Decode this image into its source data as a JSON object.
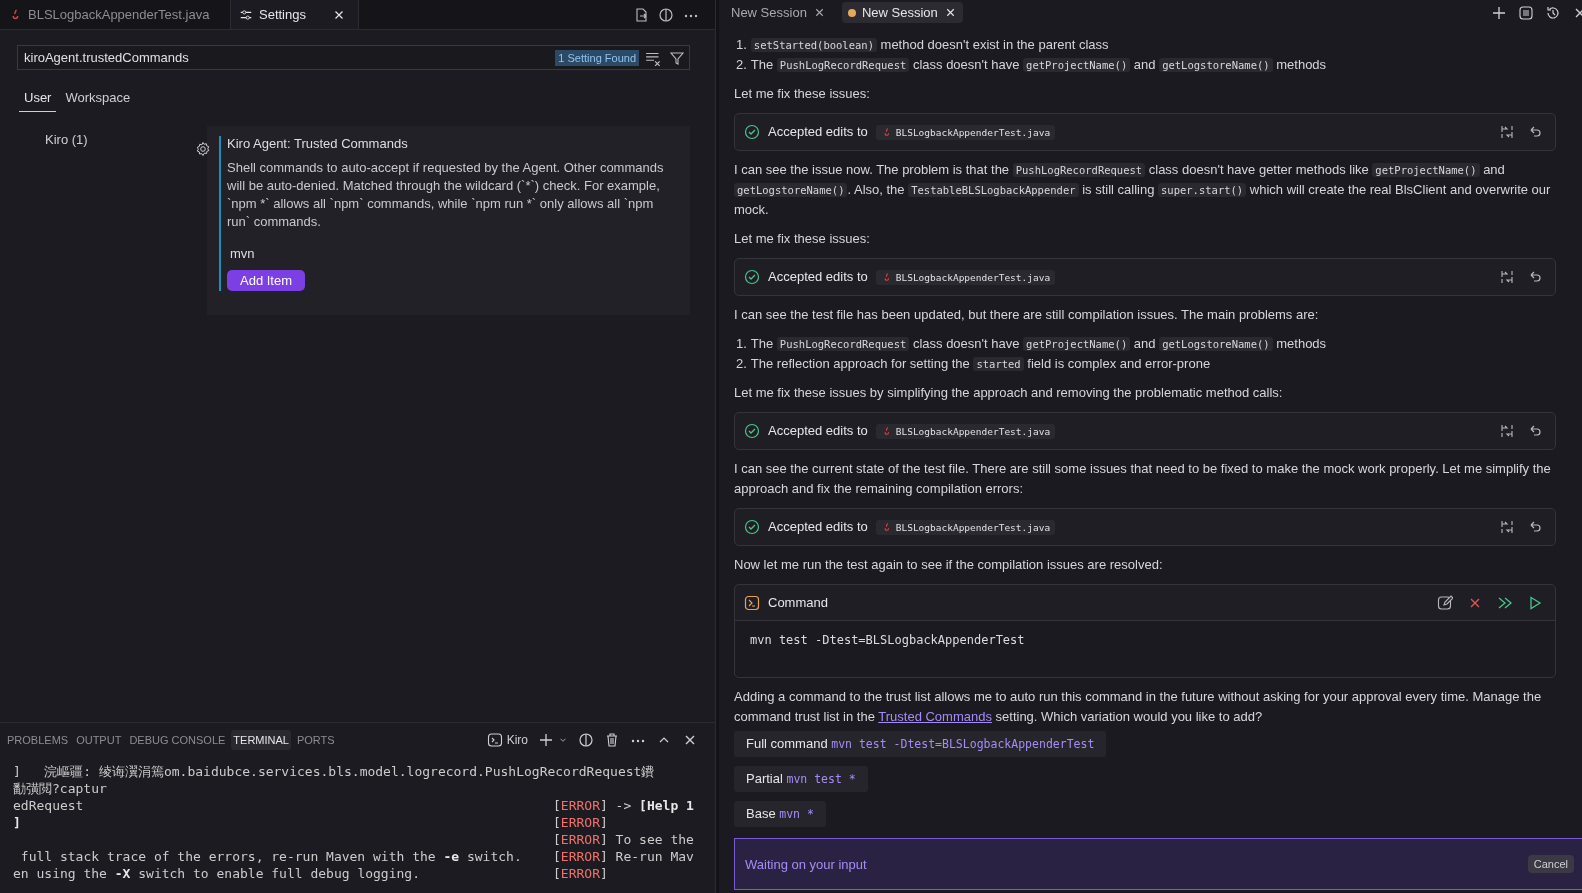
{
  "editor_tabs": [
    {
      "label": "BLSLogbackAppenderTest.java",
      "selected": false,
      "kind": "java"
    },
    {
      "label": "Settings",
      "selected": true,
      "kind": "settings"
    }
  ],
  "settings": {
    "search": {
      "value": "kiroAgent.trustedCommands"
    },
    "result_badge": "1 Setting Found",
    "scopes": [
      {
        "label": "User",
        "selected": true
      },
      {
        "label": "Workspace",
        "selected": false
      }
    ],
    "toc": [
      {
        "label": "Kiro (1)"
      }
    ],
    "setting": {
      "title": "Kiro Agent: Trusted Commands",
      "description": "Shell commands to auto-accept if requested by the Agent. Other commands will be auto-denied. Matched through the wildcard (`*`) check. For example, `npm *` allows all `npm` commands, while `npm run *` only allows all `npm run` commands.",
      "items": [
        "mvn"
      ],
      "add_button": "Add Item"
    }
  },
  "panel": {
    "tabs": [
      {
        "label": "PROBLEMS",
        "selected": false
      },
      {
        "label": "OUTPUT",
        "selected": false
      },
      {
        "label": "DEBUG CONSOLE",
        "selected": false
      },
      {
        "label": "TERMINAL",
        "selected": true
      },
      {
        "label": "PORTS",
        "selected": false
      }
    ],
    "terminal_profile": "Kiro",
    "terminal": [
      {
        "kind": "full",
        "left": [
          {
            "kind": "text",
            "text": "]   浣嶇疆: 绫诲瀷涓篶om.baidubce.services.bls.model.logrecord.PushLogRecordRequest鐨"
          }
        ]
      },
      {
        "kind": "full",
        "left": [
          {
            "kind": "text",
            "text": "勫彉閲?captur"
          }
        ]
      },
      {
        "kind": "split",
        "left": [
          {
            "kind": "text",
            "text": "edRequest"
          }
        ],
        "right": [
          {
            "kind": "text",
            "text": "["
          },
          {
            "kind": "error",
            "text": "ERROR"
          },
          {
            "kind": "text",
            "text": "] -> "
          },
          {
            "kind": "bold",
            "text": "[Help 1"
          }
        ]
      },
      {
        "kind": "split",
        "left": [
          {
            "kind": "bold",
            "text": "]"
          }
        ],
        "right": [
          {
            "kind": "text",
            "text": "["
          },
          {
            "kind": "error",
            "text": "ERROR"
          },
          {
            "kind": "text",
            "text": "]"
          }
        ]
      },
      {
        "kind": "split",
        "right": [
          {
            "kind": "text",
            "text": "["
          },
          {
            "kind": "error",
            "text": "ERROR"
          },
          {
            "kind": "text",
            "text": "] To see the"
          }
        ]
      },
      {
        "kind": "split",
        "left": [
          {
            "kind": "text",
            "text": " full stack trace of the errors, re-run Maven with the "
          },
          {
            "kind": "bold",
            "text": "-e"
          },
          {
            "kind": "text",
            "text": " switch."
          }
        ],
        "right": [
          {
            "kind": "text",
            "text": "["
          },
          {
            "kind": "error",
            "text": "ERROR"
          },
          {
            "kind": "text",
            "text": "] Re-run Mav"
          }
        ]
      },
      {
        "kind": "split",
        "left": [
          {
            "kind": "text",
            "text": "en using the "
          },
          {
            "kind": "bold",
            "text": "-X"
          },
          {
            "kind": "text",
            "text": " switch to enable full debug logging."
          }
        ],
        "right": [
          {
            "kind": "text",
            "text": "["
          },
          {
            "kind": "error",
            "text": "ERROR"
          },
          {
            "kind": "text",
            "text": "]"
          }
        ]
      }
    ]
  },
  "chat": {
    "tabs": [
      {
        "label": "New Session",
        "selected": false,
        "unsaved": false
      },
      {
        "label": "New Session",
        "selected": true,
        "unsaved": true
      }
    ],
    "messages": [
      {
        "kind": "list",
        "items": [
          {
            "marker": "1.",
            "segments": [
              {
                "kind": "code",
                "text": "setStarted(boolean)"
              },
              {
                "kind": "text",
                "text": " method doesn't exist in the parent class"
              }
            ]
          },
          {
            "marker": "2.",
            "segments": [
              {
                "kind": "text",
                "text": "The "
              },
              {
                "kind": "code",
                "text": "PushLogRecordRequest"
              },
              {
                "kind": "text",
                "text": " class doesn't have "
              },
              {
                "kind": "code",
                "text": "getProjectName()"
              },
              {
                "kind": "text",
                "text": " and "
              },
              {
                "kind": "code",
                "text": "getLogstoreName()"
              },
              {
                "kind": "text",
                "text": " methods"
              }
            ]
          }
        ]
      },
      {
        "kind": "para",
        "segments": [
          {
            "kind": "text",
            "text": "Let me fix these issues:"
          }
        ]
      },
      {
        "kind": "edit",
        "label": "Accepted edits to",
        "file": "BLSLogbackAppenderTest.java"
      },
      {
        "kind": "para",
        "segments": [
          {
            "kind": "text",
            "text": "I can see the issue now. The problem is that the "
          },
          {
            "kind": "code",
            "text": "PushLogRecordRequest"
          },
          {
            "kind": "text",
            "text": " class doesn't have getter methods like "
          },
          {
            "kind": "code",
            "text": "getProjectName()"
          },
          {
            "kind": "text",
            "text": " and "
          },
          {
            "kind": "code",
            "text": "getLogstoreName()"
          },
          {
            "kind": "text",
            "text": ". Also, the "
          },
          {
            "kind": "code",
            "text": "TestableBLSLogbackAppender"
          },
          {
            "kind": "text",
            "text": " is still calling "
          },
          {
            "kind": "code",
            "text": "super.start()"
          },
          {
            "kind": "text",
            "text": " which will create the real BlsClient and overwrite our mock."
          }
        ]
      },
      {
        "kind": "para",
        "segments": [
          {
            "kind": "text",
            "text": "Let me fix these issues:"
          }
        ]
      },
      {
        "kind": "edit",
        "label": "Accepted edits to",
        "file": "BLSLogbackAppenderTest.java"
      },
      {
        "kind": "para",
        "segments": [
          {
            "kind": "text",
            "text": "I can see the test file has been updated, but there are still compilation issues. The main problems are:"
          }
        ]
      },
      {
        "kind": "list",
        "items": [
          {
            "marker": "1.",
            "segments": [
              {
                "kind": "text",
                "text": "The "
              },
              {
                "kind": "code",
                "text": "PushLogRecordRequest"
              },
              {
                "kind": "text",
                "text": " class doesn't have "
              },
              {
                "kind": "code",
                "text": "getProjectName()"
              },
              {
                "kind": "text",
                "text": " and "
              },
              {
                "kind": "code",
                "text": "getLogstoreName()"
              },
              {
                "kind": "text",
                "text": " methods"
              }
            ]
          },
          {
            "marker": "2.",
            "segments": [
              {
                "kind": "text",
                "text": "The reflection approach for setting the "
              },
              {
                "kind": "code",
                "text": "started"
              },
              {
                "kind": "text",
                "text": " field is complex and error-prone"
              }
            ]
          }
        ]
      },
      {
        "kind": "para",
        "segments": [
          {
            "kind": "text",
            "text": "Let me fix these issues by simplifying the approach and removing the problematic method calls:"
          }
        ]
      },
      {
        "kind": "edit",
        "label": "Accepted edits to",
        "file": "BLSLogbackAppenderTest.java"
      },
      {
        "kind": "para",
        "segments": [
          {
            "kind": "text",
            "text": "I can see the current state of the test file. There are still some issues that need to be fixed to make the mock work properly. Let me simplify the approach and fix the remaining compilation errors:"
          }
        ]
      },
      {
        "kind": "edit",
        "label": "Accepted edits to",
        "file": "BLSLogbackAppenderTest.java"
      },
      {
        "kind": "para",
        "segments": [
          {
            "kind": "text",
            "text": "Now let me run the test again to see if the compilation issues are resolved:"
          }
        ]
      },
      {
        "kind": "command",
        "title": "Command",
        "code": "mvn test -Dtest=BLSLogbackAppenderTest"
      },
      {
        "kind": "para",
        "segments": [
          {
            "kind": "text",
            "text": "Adding a command to the trust list allows me to auto run this command in the future without asking for your approval every time. Manage the command trust list in the "
          },
          {
            "kind": "link",
            "text": "Trusted Commands"
          },
          {
            "kind": "text",
            "text": " setting. Which variation would you like to add?"
          }
        ]
      }
    ],
    "options": [
      {
        "label": "Full command",
        "command": "mvn test -Dtest=BLSLogbackAppenderTest"
      },
      {
        "label": "Partial",
        "command": "mvn test *"
      },
      {
        "label": "Base",
        "command": "mvn *"
      }
    ],
    "input": {
      "placeholder": "Waiting on your input",
      "cancel": "Cancel"
    }
  }
}
